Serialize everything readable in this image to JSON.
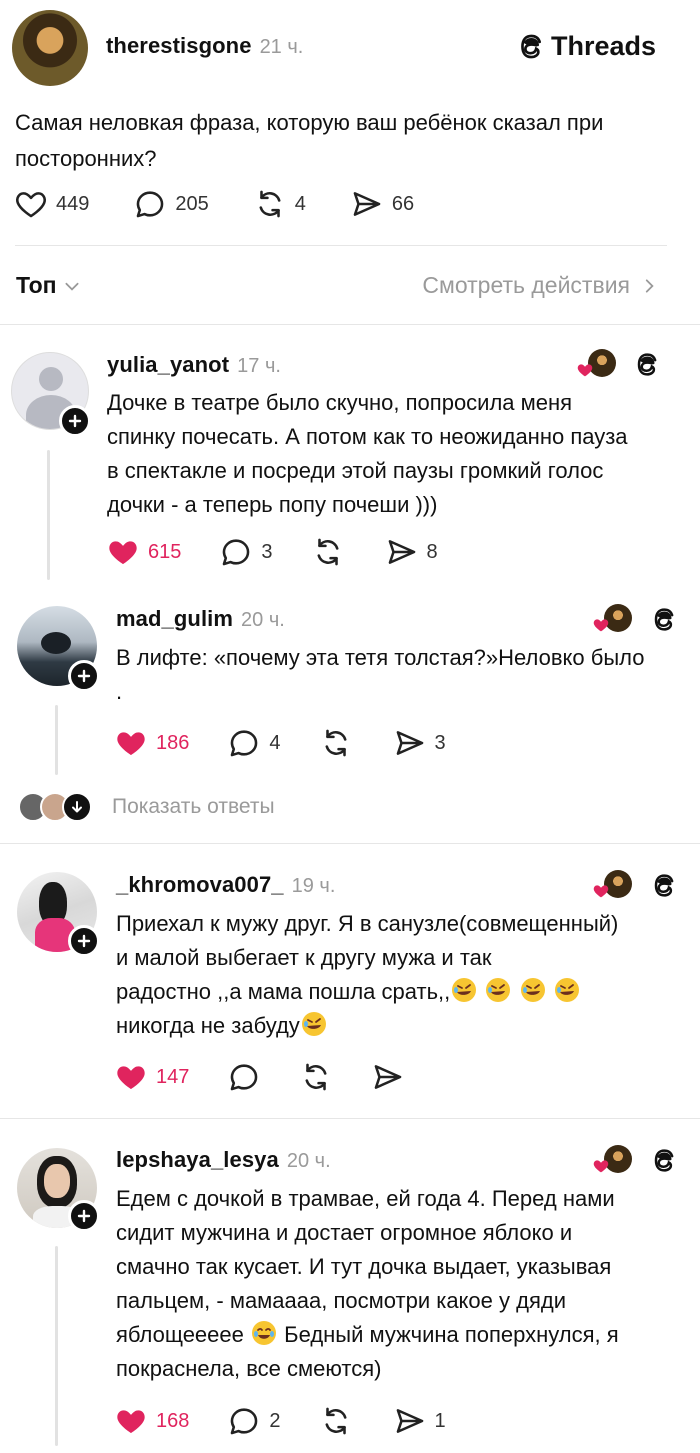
{
  "post": {
    "username": "therestisgone",
    "time": "21 ч.",
    "brand": "Threads",
    "text": "Самая неловкая фраза, которую ваш ребёнок сказал при посторонних?",
    "likes": "449",
    "replies": "205",
    "reposts": "4",
    "shares": "66"
  },
  "sort": {
    "label": "Топ",
    "activity_link": "Смотреть действия"
  },
  "replies": [
    {
      "username": "yulia_yanot",
      "time": "17 ч.",
      "text": "Дочке в театре было скучно, попросила меня спинку почесать. А потом как то неожиданно пауза в спектакле и посреди этой паузы громкий голос дочки - а теперь попу почеши )))",
      "likes": "615",
      "replies": "3",
      "reposts": "",
      "shares": "8"
    },
    {
      "username": "mad_gulim",
      "time": "20 ч.",
      "text": "В лифте: «почему эта тетя толстая?»Неловко было .",
      "likes": "186",
      "replies": "4",
      "reposts": "",
      "shares": "3"
    },
    {
      "username": "_khromova007_",
      "time": "19 ч.",
      "text_line1": "Приехал к мужу друг. Я в санузле(совмещенный)",
      "text_line2": "и малой выбегает к другу мужа и так",
      "text_line3": "радостно ,,а мама пошла срать,,",
      "text_line4": "никогда не забуду",
      "likes": "147",
      "replies": "",
      "reposts": "",
      "shares": ""
    },
    {
      "username": "lepshaya_lesya",
      "time": "20 ч.",
      "text_line1": "Едем с дочкой в трамвае, ей года 4. Перед нами",
      "text_line2": "сидит мужчина и достает огромное яблоко и",
      "text_line3": "смачно так кусает. И тут дочка выдает, указывая",
      "text_line4": "пальцем, - мамаааа, посмотри какое у дяди",
      "text_line5a": "яблощеееее",
      "text_line5b": "Бедный мужчина поперхнулся, я",
      "text_line6": "покраснела, все смеются)",
      "likes": "168",
      "replies": "2",
      "reposts": "",
      "shares": "1"
    }
  ],
  "show_replies": "Показать ответы",
  "colors": {
    "like_red": "#e0245e",
    "muted": "#9a9a9a"
  }
}
